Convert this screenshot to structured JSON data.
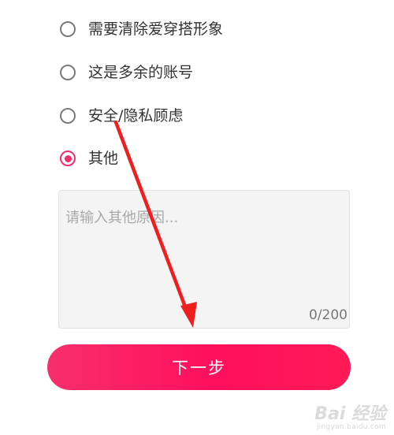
{
  "reasons": {
    "options": [
      {
        "label": "需要清除爱穿搭形象",
        "selected": false
      },
      {
        "label": "这是多余的账号",
        "selected": false
      },
      {
        "label": "安全/隐私顾虑",
        "selected": false
      },
      {
        "label": "其他",
        "selected": true
      }
    ],
    "accent_color": "#f0306a"
  },
  "other_reason": {
    "placeholder": "请输入其他原因...",
    "value": "",
    "counter": "0/200"
  },
  "next_button": {
    "label": "下一步"
  },
  "annotation": {
    "color": "#f01e1e"
  },
  "watermark": {
    "text": "Bai 经验",
    "url": "jingyan.baidu.com"
  }
}
